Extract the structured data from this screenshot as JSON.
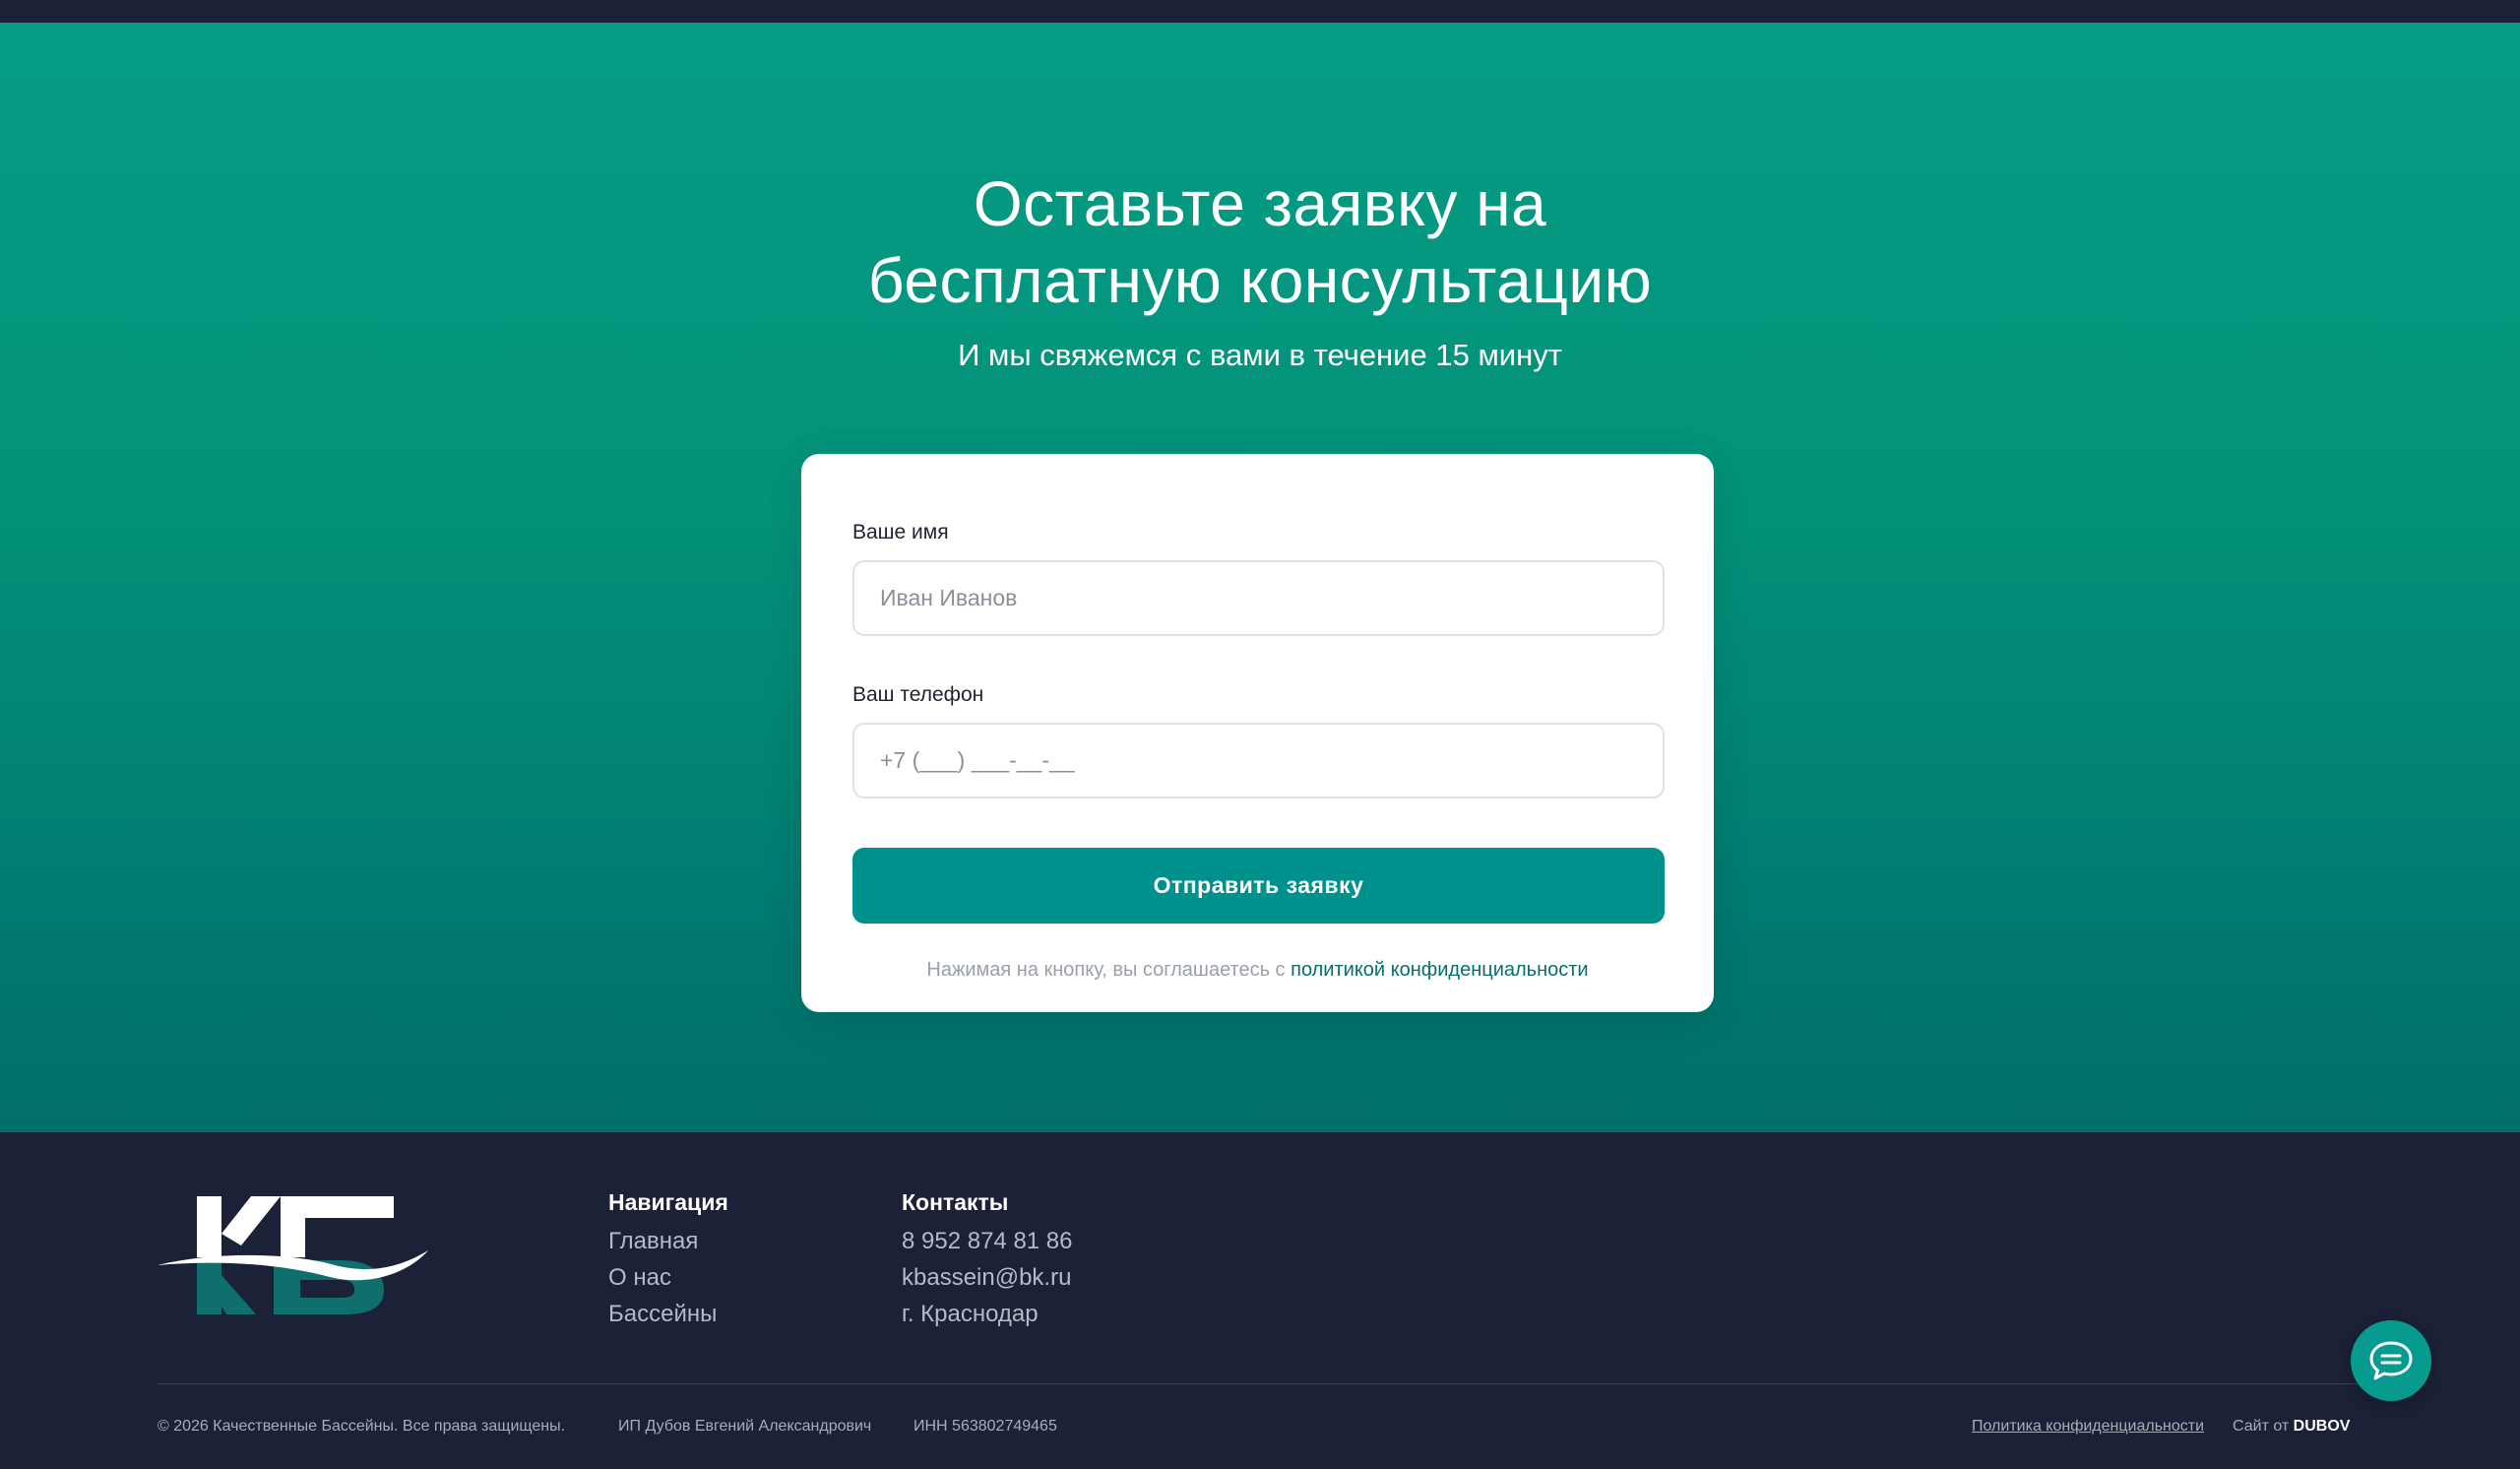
{
  "hero": {
    "title_line1": "Оставьте заявку на",
    "title_line2": "бесплатную консультацию",
    "subtitle": "И мы свяжемся с вами в течение 15 минут"
  },
  "form": {
    "name_label": "Ваше имя",
    "name_placeholder": "Иван Иванов",
    "name_value": "",
    "phone_label": "Ваш телефон",
    "phone_placeholder": "+7 (___) ___-__-__",
    "phone_value": "",
    "submit_label": "Отправить заявку",
    "agree_text": "Нажимая на кнопку, вы соглашаетесь с ",
    "agree_link": "политикой конфиденциальности"
  },
  "footer": {
    "logo_text": "КБ",
    "nav_title": "Навигация",
    "nav_items": [
      "Главная",
      "О нас",
      "Бассейны"
    ],
    "contacts_title": "Контакты",
    "contacts": [
      "8 952 874 81 86",
      "kbassein@bk.ru",
      "г. Краснодар"
    ],
    "copyright": "© 2026 Качественные Бассейны. Все права защищены.",
    "owner": "ИП Дубов Евгений Александрович",
    "inn": "ИНН 563802749465",
    "privacy_link": "Политика конфиденциальности",
    "site_by_prefix": "Сайт от ",
    "site_by_brand": "DUBOV"
  },
  "chat": {
    "icon": "chat-bubble-icon"
  },
  "colors": {
    "hero_top": "#069c84",
    "hero_bottom": "#017069",
    "button": "#00918c",
    "footer_bg": "#1b2136",
    "link": "#0a6e6e"
  }
}
